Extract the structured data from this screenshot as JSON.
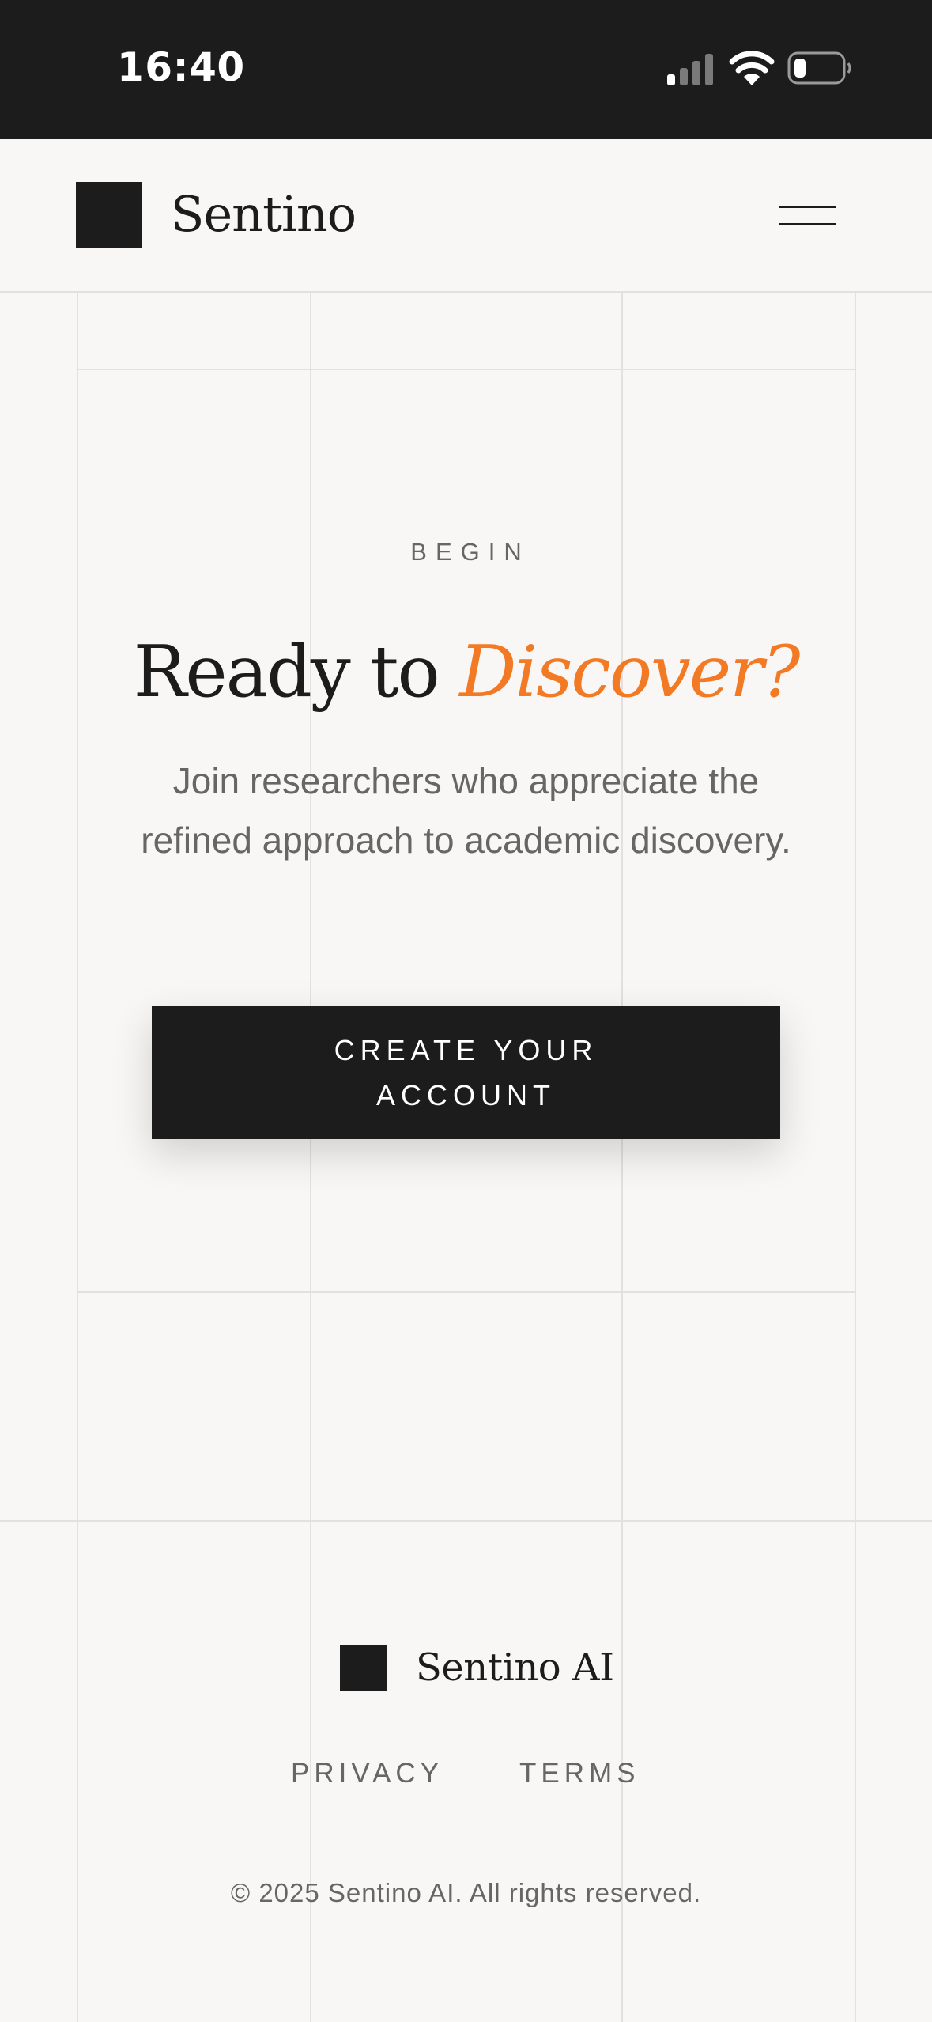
{
  "status_bar": {
    "time": "16:40"
  },
  "header": {
    "brand": "Sentino",
    "menu_icon": "hamburger-menu-icon"
  },
  "cta": {
    "label": "BEGIN",
    "title_plain": "Ready to ",
    "title_accent": "Discover?",
    "description": "Join researchers who appreciate the refined approach to academic discovery.",
    "button_label": "CREATE YOUR ACCOUNT"
  },
  "footer": {
    "brand": "Sentino AI",
    "links": [
      {
        "label": "PRIVACY"
      },
      {
        "label": "TERMS"
      }
    ],
    "copyright": "© 2025 Sentino AI. All rights reserved."
  },
  "colors": {
    "status_bar": "#1c1c1c",
    "background": "#f8f7f5",
    "text": "#1c1c1c",
    "muted_text": "#666666",
    "accent": "#f37a25",
    "grid": "#e3e1de"
  }
}
